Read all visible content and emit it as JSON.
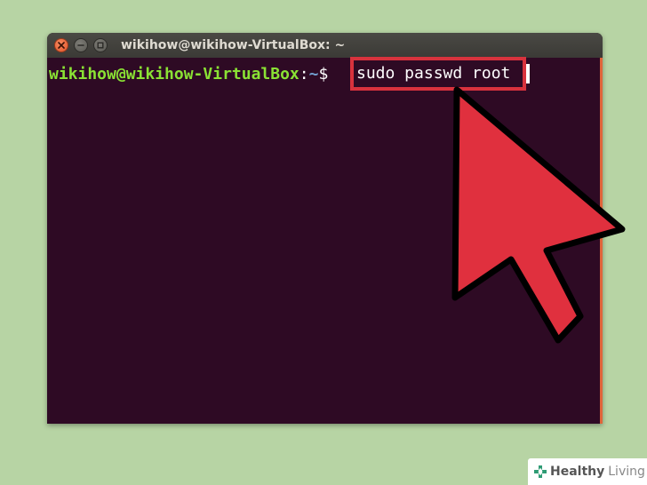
{
  "window": {
    "title": "wikihow@wikihow-VirtualBox: ~",
    "buttons": [
      "close",
      "minimize",
      "maximize"
    ]
  },
  "terminal": {
    "prompt_user_host": "wikihow@wikihow-VirtualBox",
    "prompt_separator": ":",
    "prompt_path": "~",
    "prompt_symbol": "$",
    "command": "sudo passwd root"
  },
  "colors": {
    "background": "#b7d4a4",
    "terminal_bg": "#2e0a24",
    "prompt_user": "#8ae234",
    "prompt_path": "#729fcf",
    "highlight_box": "#d8323d",
    "pointer": "#e0303e"
  },
  "icons": {
    "close": "close-icon",
    "minimize": "minimize-icon",
    "maximize": "maximize-icon",
    "pointer": "arrow-pointer-icon",
    "watermark": "healthy-living-logo"
  },
  "watermark": {
    "brand": "Healthy",
    "brand_suffix": "Living"
  }
}
